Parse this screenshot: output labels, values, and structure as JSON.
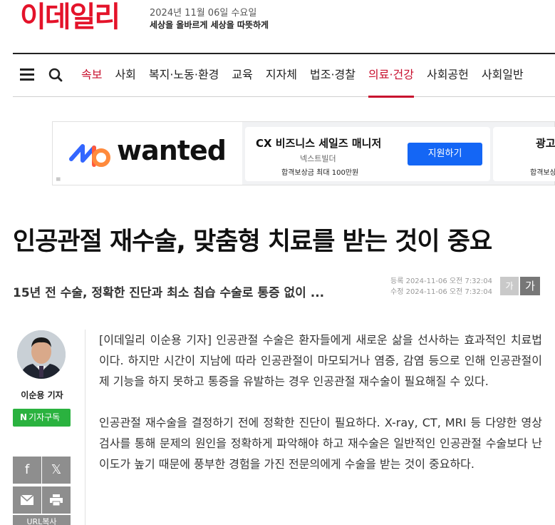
{
  "header": {
    "logo": "이데일리",
    "date": "2024년 11월 06일 수요일",
    "slogan": "세상을 올바르게 세상을 따뜻하게"
  },
  "nav": {
    "items": [
      "속보",
      "사회",
      "복지·노동·환경",
      "교육",
      "지자체",
      "법조·경찰",
      "의료·건강",
      "사회공헌",
      "사회일반"
    ],
    "active": "의료·건강"
  },
  "ad": {
    "brand": "wanted",
    "job_title": "CX 비즈니스 세일즈 매니저",
    "company": "넥스트빌더",
    "reward": "합격보상금 최대 100만원",
    "apply_label": "지원하기",
    "card2_title": "광고",
    "card2_reward": "합격보상금"
  },
  "article": {
    "title": "인공관절 재수술, 맞춤형 치료를 받는 것이 중요",
    "subtitle": "15년 전 수술, 정확한 진단과 최소 침습 수술로 통증 없이 ...",
    "registered": "등록 2024-11-06 오전 7:32:04",
    "modified": "수정 2024-11-06 오전 7:32:04",
    "font_small": "가",
    "font_large": "가",
    "reporter": "이순용 기자",
    "subscribe_n": "N",
    "subscribe_label": "기자구독",
    "share_copy": "URL복사",
    "paragraphs": [
      "[이데일리 이순용 기자] 인공관절 수술은 환자들에게 새로운 삶을 선사하는 효과적인 치료법이다. 하지만 시간이 지남에 따라 인공관절이 마모되거나 염증, 감염 등으로 인해 인공관절이 제 기능을 하지 못하고 통증을 유발하는 경우 인공관절 재수술이 필요해질 수 있다.",
      "인공관절 재수술을 결정하기 전에 정확한 진단이 필요하다. X-ray, CT, MRI 등 다양한 영상 검사를 통해 문제의 원인을 정확하게 파악해야 하고 재수술은 일반적인 인공관절 수술보다 난이도가 높기 때문에 풍부한 경험을 가진 전문의에게 수술을 받는 것이 중요하다."
    ]
  },
  "colors": {
    "brand_red": "#e4132a",
    "subscribe_green": "#2ab23f",
    "apply_blue": "#1466f5"
  }
}
